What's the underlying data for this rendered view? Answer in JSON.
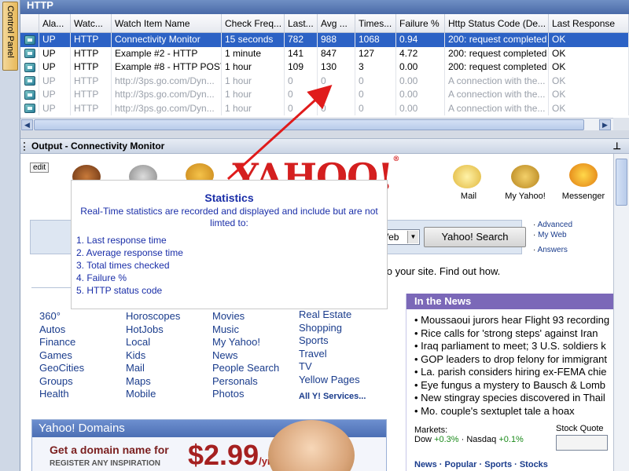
{
  "control_panel": {
    "label": "Control Panel"
  },
  "http_panel": {
    "title": "HTTP",
    "columns": [
      "",
      "Ala...",
      "Watc...",
      "Watch Item Name",
      "Check Freq...",
      "Last...",
      "Avg ...",
      "Times...",
      "Failure %",
      "Http Status Code (De...",
      "Last Response"
    ],
    "rows": [
      {
        "selected": true,
        "dim": false,
        "cells": [
          "",
          "UP",
          "HTTP",
          "Connectivity Monitor",
          "15 seconds",
          "782",
          "988",
          "1068",
          "0.94",
          "200: request completed",
          "OK"
        ]
      },
      {
        "selected": false,
        "dim": false,
        "cells": [
          "",
          "UP",
          "HTTP",
          "Example #2 - HTTP",
          "1 minute",
          "141",
          "847",
          "127",
          "4.72",
          "200: request completed",
          "OK"
        ]
      },
      {
        "selected": false,
        "dim": false,
        "cells": [
          "",
          "UP",
          "HTTP",
          "Example #8 - HTTP POST",
          "1 hour",
          "109",
          "130",
          "3",
          "0.00",
          "200: request completed",
          "OK"
        ]
      },
      {
        "selected": false,
        "dim": true,
        "cells": [
          "",
          "UP",
          "HTTP",
          "http://3ps.go.com/Dyn...",
          "1 hour",
          "0",
          "0",
          "0",
          "0.00",
          "A connection with the...",
          "OK"
        ]
      },
      {
        "selected": false,
        "dim": true,
        "cells": [
          "",
          "UP",
          "HTTP",
          "http://3ps.go.com/Dyn...",
          "1 hour",
          "0",
          "0",
          "0",
          "0.00",
          "A connection with the...",
          "OK"
        ]
      },
      {
        "selected": false,
        "dim": true,
        "cells": [
          "",
          "UP",
          "HTTP",
          "http://3ps.go.com/Dyn...",
          "1 hour",
          "0",
          "0",
          "0",
          "0.00",
          "A connection with the...",
          "OK"
        ]
      }
    ]
  },
  "output_panel": {
    "title": "Output - Connectivity Monitor",
    "pin": "⊥"
  },
  "yahoo": {
    "edit": "edit",
    "logo": "YAHOO!",
    "reg": "®",
    "top_links": [
      {
        "label": "Mail",
        "icon": "mail-icon"
      },
      {
        "label": "My Yahoo!",
        "icon": "my-yahoo-icon"
      },
      {
        "label": "Messenger",
        "icon": "messenger-icon"
      }
    ],
    "search_select": "Web",
    "search_button": "Yahoo! Search",
    "search_links": [
      "Advanced",
      "My Web",
      "Answers"
    ],
    "tagline": "s to your site. Find out how.",
    "directory": {
      "col1": [
        "360°",
        "Autos",
        "Finance",
        "Games",
        "GeoCities",
        "Groups",
        "Health"
      ],
      "col2": [
        "Horoscopes",
        "HotJobs",
        "Local",
        "Kids",
        "Mail",
        "Maps",
        "Mobile"
      ],
      "col3": [
        "Movies",
        "Music",
        "My Yahoo!",
        "News",
        "People Search",
        "Personals",
        "Photos"
      ],
      "col4": [
        "Real Estate",
        "Shopping",
        "Sports",
        "Travel",
        "TV",
        "Yellow Pages"
      ],
      "all_services": "All Y! Services..."
    },
    "news": {
      "heading": "In the News",
      "items": [
        "Moussaoui jurors hear Flight 93 recording",
        "Rice calls for 'strong steps' against Iran",
        "Iraq parliament to meet; 3 U.S. soldiers k",
        "GOP leaders to drop felony for immigrant",
        "La. parish considers hiring ex-FEMA chie",
        "Eye fungus a mystery to Bausch & Lomb",
        "New stingray species discovered in Thail",
        "Mo. couple's sextuplet tale a hoax"
      ],
      "markets_label": "Markets:",
      "dow": "Dow",
      "dow_change": "+0.3%",
      "nasdaq": "Nasdaq",
      "nasdaq_change": "+0.1%",
      "stock_quote": "Stock Quote",
      "tabs": "News · Popular · Sports · Stocks"
    },
    "domains": {
      "heading": "Yahoo! Domains",
      "line1": "Get a domain name for",
      "line2": "REGISTER ANY INSPIRATION",
      "price": "$2.99",
      "per": "/yr"
    }
  },
  "callout": {
    "title": "Statistics",
    "description": "Real-Time statistics are recorded and displayed and include but are not limted to:",
    "items": [
      "1. Last response time",
      "2. Average response time",
      "3. Total times checked",
      "4. Failure %",
      "5. HTTP status code"
    ]
  },
  "colors": {
    "selection": "#2c62c5",
    "callout_text": "#1a2ea8",
    "arrow": "#e01b1b",
    "yahoo_red": "#d41f1f",
    "news_header": "#7b68b8"
  }
}
